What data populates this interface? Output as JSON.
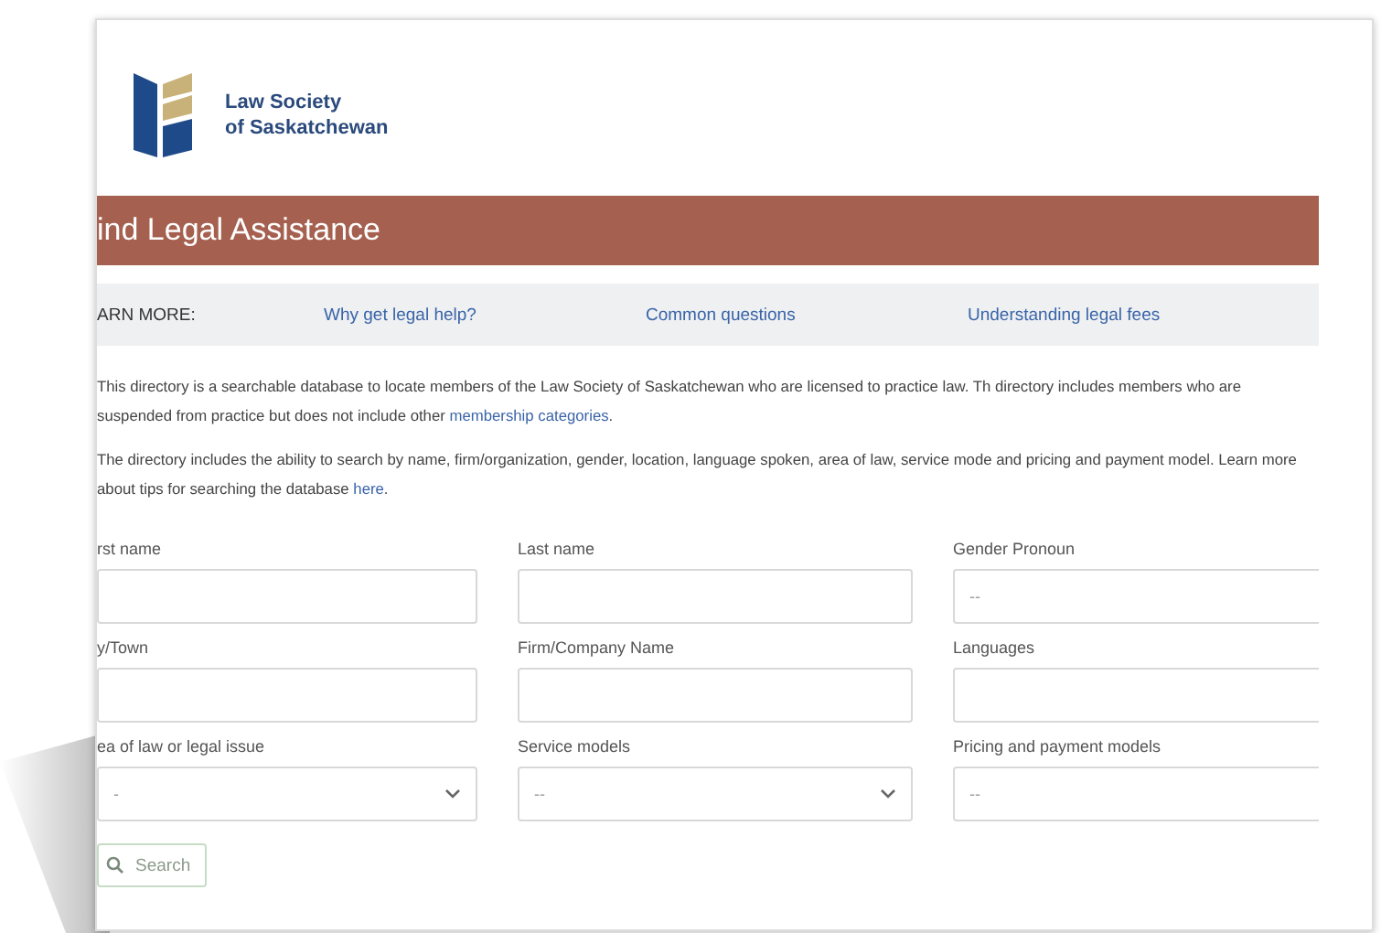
{
  "logo": {
    "line1": "Law Society",
    "line2": "of Saskatchewan"
  },
  "banner": {
    "title": "ind Legal Assistance"
  },
  "learn_more": {
    "label": "ARN MORE:",
    "links": [
      "Why get legal help?",
      "Common questions",
      "Understanding legal fees"
    ]
  },
  "intro": [
    {
      "text": "This directory is a searchable database to locate members of the Law Society of Saskatchewan who are licensed to practice law. Th directory includes members who are suspended from practice but does not include other ",
      "link": "membership categories",
      "after": "."
    },
    {
      "text": "The directory includes the ability to search by name, firm/organization, gender, location, language spoken, area of law, service mode and pricing and payment model. Learn more about tips for searching the database ",
      "link": "here",
      "after": "."
    }
  ],
  "form": {
    "fields": [
      {
        "label": "rst name",
        "kind": "text"
      },
      {
        "label": "Last name",
        "kind": "text"
      },
      {
        "label": "Gender Pronoun",
        "kind": "select",
        "placeholder": "--"
      },
      {
        "label": "y/Town",
        "kind": "text"
      },
      {
        "label": "Firm/Company Name",
        "kind": "text"
      },
      {
        "label": "Languages",
        "kind": "text"
      },
      {
        "label": "ea of law or legal issue",
        "kind": "select",
        "placeholder": "-"
      },
      {
        "label": "Service models",
        "kind": "select",
        "placeholder": "--"
      },
      {
        "label": "Pricing and payment models",
        "kind": "select",
        "placeholder": "--"
      }
    ],
    "search_button": "Search"
  }
}
